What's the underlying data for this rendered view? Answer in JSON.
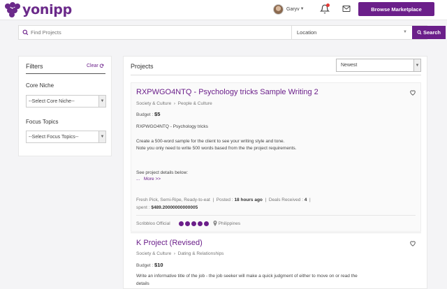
{
  "header": {
    "logo_text": "yonipp",
    "user_name": "Garyv",
    "browse_label": "Browse Marketplace"
  },
  "search": {
    "placeholder": "Find Projects",
    "location_value": "Location",
    "button_label": "Search"
  },
  "filters": {
    "title": "Filters",
    "clear_label": "Clear",
    "core_niche_label": "Core Niche",
    "core_niche_value": "--Select Core Niche--",
    "focus_topics_label": "Focus Topics",
    "focus_topics_value": "--Select Focus Topics--"
  },
  "projects": {
    "title": "Projects",
    "sort_value": "Newest",
    "items": [
      {
        "title": "RXPWGO4NTQ - Psychology tricks Sample Writing 2",
        "category": "Society & Culture",
        "subcategory": "People & Culture",
        "budget_label": "Budget :",
        "budget": "$5",
        "desc_lines": [
          "RXPWGO4NTQ - Psychology tricks",
          "Create a 500-word sample for the client to see your writing style and tone.",
          "Note you only need to write 500 words based from the the project requirements.",
          "See project details below:",
          "..."
        ],
        "more_label": "More >>",
        "tags": "Fresh Pick, Semi-Ripe, Ready-to-eat",
        "posted_label": "Posted :",
        "posted": "18 hours ago",
        "deals_label": "Deals Received :",
        "deals": "4",
        "spent_label": "spent :",
        "spent": "$489.20000000000005",
        "client_name": "Scribbloo Official",
        "client_location": "Philippines"
      },
      {
        "title": "K Project (Revised)",
        "category": "Society & Culture",
        "subcategory": "Dating & Relationships",
        "budget_label": "Budget :",
        "budget": "$10",
        "desc_lines": [
          "Write an informative title of the job - the job seeker will make a quick judgment of either to move on or read the",
          "details"
        ]
      }
    ]
  },
  "colors": {
    "brand": "#6b1f8a",
    "notification": "#e53935"
  }
}
